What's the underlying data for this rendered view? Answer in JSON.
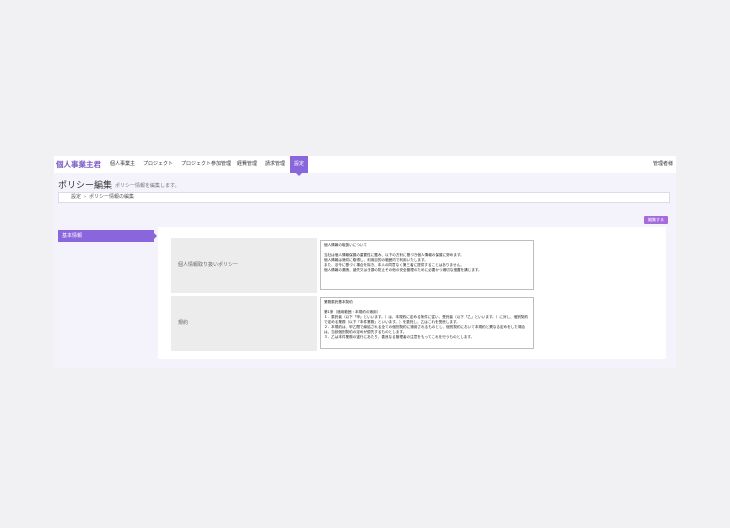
{
  "header": {
    "brand": "個人事業主君",
    "nav": [
      {
        "label": "個人事業主"
      },
      {
        "label": "プロジェクト"
      },
      {
        "label": "プロジェクト参加管理"
      },
      {
        "label": "経費管理"
      },
      {
        "label": "請求管理"
      },
      {
        "label": "設定",
        "active": true
      }
    ],
    "admin_link": "管理者様"
  },
  "page": {
    "title": "ポリシー編集",
    "subtitle": "ポリシー情報を編集します。"
  },
  "breadcrumb": [
    "設定",
    "ポリシー情報の編集"
  ],
  "edit_button": "編集する",
  "sidebar": {
    "tabs": [
      {
        "label": "基本情報",
        "active": true
      }
    ]
  },
  "form": {
    "privacy": {
      "label": "個人情報取り扱いポリシー",
      "value": "個人情報の取扱いについて\n\n当社は個人情報保護の重要性に鑑み、以下の方針に基づき個人情報の保護に努めます。\n個人情報は適切に取得し、利用目的の範囲内で利用いたします。\nまた、法令に基づく場合を除き、本人の同意なく第三者に提供することはありません。\n個人情報の漏洩、滅失又はき損の防止その他の安全管理のために必要かつ適切な措置を講じます。"
    },
    "terms": {
      "label": "規約",
      "value": "業務委託基本契約\n\n第1条（適用範囲・本規約の適用）\n１．委託者（以下「甲」といいます。）は、本規約に定める条件に従い、受託者（以下「乙」といいます。）に対し、個別契約で定める業務（以下「本件業務」といいます。）を委託し、乙はこれを受託します。\n２．本規約は、甲乙間で締結される全ての個別契約に適用されるものとし、個別契約において本規約と異なる定めをした場合は、当該個別契約の定めが優先するものとします。\n３．乙は本件業務の遂行にあたり、善良なる管理者の注意をもってこれを行うものとします。"
    }
  }
}
